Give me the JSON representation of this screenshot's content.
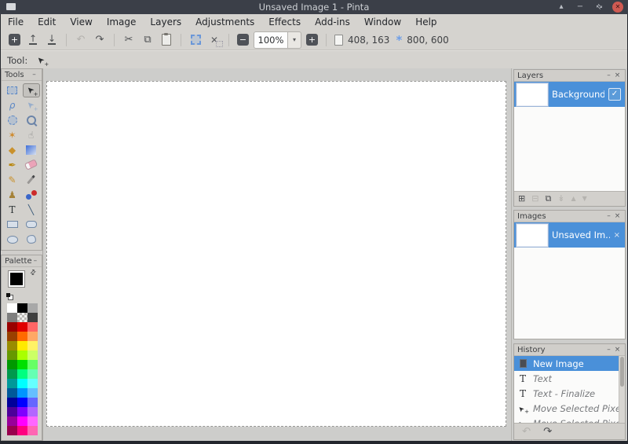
{
  "window": {
    "title": "Unsaved Image 1 - Pinta",
    "controls": {
      "shade": "▴",
      "minimize": "−",
      "restore": "⇄",
      "close": "✕"
    }
  },
  "menubar": {
    "items": [
      "File",
      "Edit",
      "View",
      "Image",
      "Layers",
      "Adjustments",
      "Effects",
      "Add-ins",
      "Window",
      "Help"
    ]
  },
  "toolbar": {
    "zoom_value": "100%",
    "zoom_dropdown_glyph": "▾",
    "cursor_position": "408, 163",
    "image_size": "800, 600",
    "items": [
      {
        "kind": "dark",
        "name": "new-image-button",
        "glyph": "+"
      },
      {
        "kind": "glyph",
        "name": "open-button",
        "glyph": "↑",
        "underbar": true
      },
      {
        "kind": "glyph",
        "name": "save-button",
        "glyph": "↓",
        "underbar": true
      },
      {
        "kind": "sep"
      },
      {
        "kind": "glyph",
        "name": "undo-button",
        "glyph": "↶",
        "disabled": true
      },
      {
        "kind": "glyph",
        "name": "redo-button",
        "glyph": "↷"
      },
      {
        "kind": "sep"
      },
      {
        "kind": "glyph",
        "name": "cut-button",
        "glyph": "✂"
      },
      {
        "kind": "glyph",
        "name": "copy-button",
        "glyph": "⧉"
      },
      {
        "kind": "paste",
        "name": "paste-button"
      },
      {
        "kind": "sep"
      },
      {
        "kind": "crop",
        "name": "crop-to-selection-button"
      },
      {
        "kind": "deselect",
        "name": "deselect-all-button",
        "glyph": "✕"
      },
      {
        "kind": "sep"
      },
      {
        "kind": "dark",
        "name": "zoom-out-button",
        "glyph": "−"
      },
      {
        "kind": "combo",
        "name": "zoom-combo"
      },
      {
        "kind": "dark",
        "name": "zoom-in-button",
        "glyph": "+"
      },
      {
        "kind": "sep"
      },
      {
        "kind": "status-pos",
        "name": "cursor-position-indicator"
      },
      {
        "kind": "status-size",
        "name": "image-size-indicator",
        "glyph": "*"
      }
    ]
  },
  "tool_options": {
    "label": "Tool:"
  },
  "tools_panel": {
    "title": "Tools",
    "minimize": "–",
    "items": [
      {
        "name": "rectangle-select-tool",
        "kind": "dashed-rect"
      },
      {
        "name": "move-selected-pixels-tool",
        "kind": "cursor",
        "selected": true
      },
      {
        "name": "lasso-select-tool",
        "kind": "glyph",
        "glyph": "ρ",
        "color": "#5b87c5",
        "italic": true
      },
      {
        "name": "move-selection-tool",
        "kind": "cursor-outline"
      },
      {
        "name": "ellipse-select-tool",
        "kind": "dashed-circle"
      },
      {
        "name": "zoom-tool",
        "kind": "magnifier"
      },
      {
        "name": "magic-wand-tool",
        "kind": "glyph",
        "glyph": "✶",
        "color": "#cf8a2d"
      },
      {
        "name": "pan-tool",
        "kind": "glyph",
        "glyph": "☝",
        "color": "#8d8d8b"
      },
      {
        "name": "paint-bucket-tool",
        "kind": "glyph",
        "glyph": "◆",
        "color": "#c9912c"
      },
      {
        "name": "gradient-tool",
        "kind": "gradient"
      },
      {
        "name": "paintbrush-tool",
        "kind": "glyph",
        "glyph": "✒",
        "color": "#b8860b"
      },
      {
        "name": "eraser-tool",
        "kind": "eraser"
      },
      {
        "name": "pencil-tool",
        "kind": "glyph",
        "glyph": "✎",
        "color": "#c9912c"
      },
      {
        "name": "color-picker-tool",
        "kind": "pipette"
      },
      {
        "name": "clone-stamp-tool",
        "kind": "glyph",
        "glyph": "♟",
        "color": "#a58238"
      },
      {
        "name": "recolor-tool",
        "kind": "recolor"
      },
      {
        "name": "text-tool",
        "kind": "glyph",
        "glyph": "T",
        "color": "#2d3436",
        "serif": true
      },
      {
        "name": "line-curve-tool",
        "kind": "glyph",
        "glyph": "╲",
        "color": "#3a5a7a"
      },
      {
        "name": "rectangle-tool",
        "kind": "shape-rect"
      },
      {
        "name": "rounded-rectangle-tool",
        "kind": "shape-round"
      },
      {
        "name": "ellipse-tool",
        "kind": "shape-ellipse"
      },
      {
        "name": "freeform-shape-tool",
        "kind": "shape-blob"
      }
    ]
  },
  "palette_panel": {
    "title": "Palette",
    "minimize": "–",
    "primary": "#000000",
    "secondary": "#ffffff",
    "swap_glyph": "⇄",
    "colors": [
      "#ffffff",
      "#000000",
      "#a8a8a8",
      "#7f7f7f",
      "checker",
      "#3f3f3f",
      "#990000",
      "#e00000",
      "#ff6666",
      "#994000",
      "#ff6a00",
      "#ffa866",
      "#998c00",
      "#ffea00",
      "#fff266",
      "#669900",
      "#aaff00",
      "#ccff66",
      "#009900",
      "#00e000",
      "#66ff66",
      "#00994d",
      "#00ff80",
      "#66ffb3",
      "#009999",
      "#00ffff",
      "#66ffff",
      "#005999",
      "#0095ff",
      "#66bfff",
      "#000099",
      "#0000ff",
      "#6666ff",
      "#4d0099",
      "#8000ff",
      "#b366ff",
      "#990099",
      "#ff00ff",
      "#ff66ff",
      "#99004d",
      "#ff0080",
      "#ff66b3"
    ]
  },
  "layers_panel": {
    "title": "Layers",
    "minimize": "–",
    "close": "×",
    "layers": [
      {
        "name": "Background",
        "visible": true,
        "check_glyph": "✓",
        "selected": true
      }
    ],
    "buttons": [
      {
        "name": "add-layer-button",
        "glyph": "⊞",
        "enabled": true
      },
      {
        "name": "delete-layer-button",
        "glyph": "⊟",
        "enabled": false
      },
      {
        "name": "duplicate-layer-button",
        "glyph": "⧉",
        "enabled": true
      },
      {
        "name": "merge-layer-down-button",
        "glyph": "↡",
        "enabled": false
      },
      {
        "name": "move-layer-up-button",
        "glyph": "▲",
        "enabled": false,
        "small": true
      },
      {
        "name": "move-layer-down-button",
        "glyph": "▼",
        "enabled": false,
        "small": true
      }
    ]
  },
  "images_panel": {
    "title": "Images",
    "minimize": "–",
    "close": "×",
    "items": [
      {
        "name": "Unsaved Im...",
        "close": "×",
        "selected": true
      }
    ]
  },
  "history_panel": {
    "title": "History",
    "minimize": "–",
    "close": "×",
    "items": [
      {
        "label": "New Image",
        "icon": "page",
        "selected": true
      },
      {
        "label": "Text",
        "icon": "text"
      },
      {
        "label": "Text - Finalize",
        "icon": "text"
      },
      {
        "label": "Move Selected Pixels",
        "icon": "cursor"
      },
      {
        "label": "Move Selected Pixels",
        "icon": "cursor"
      }
    ],
    "undo": {
      "glyph": "↶",
      "enabled": false
    },
    "redo": {
      "glyph": "↷",
      "enabled": true
    }
  },
  "colors": {
    "accent": "#4a90d9",
    "titlebar": "#3b3f48",
    "chrome": "#d5d3cf",
    "workspace": "#cdcdcb",
    "canvas": "#ffffff",
    "close_button": "#cf5a52"
  }
}
